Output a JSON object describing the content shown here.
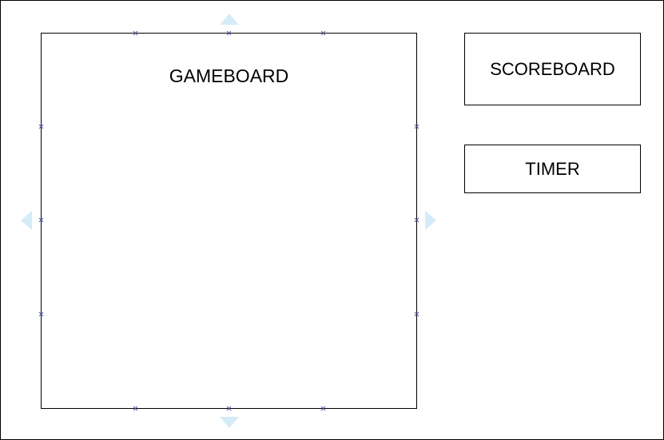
{
  "diagram": {
    "boxes": {
      "gameboard": {
        "label": "GAMEBOARD"
      },
      "scoreboard": {
        "label": "SCOREBOARD"
      },
      "timer": {
        "label": "TIMER"
      }
    },
    "colors": {
      "border": "#000000",
      "handle": "#4b57a8",
      "connection_arrow": "#d4ecf7",
      "background": "#ffffff"
    },
    "icons": {
      "handle": "x-mark-icon",
      "connection": "triangle-arrow-icon"
    }
  }
}
